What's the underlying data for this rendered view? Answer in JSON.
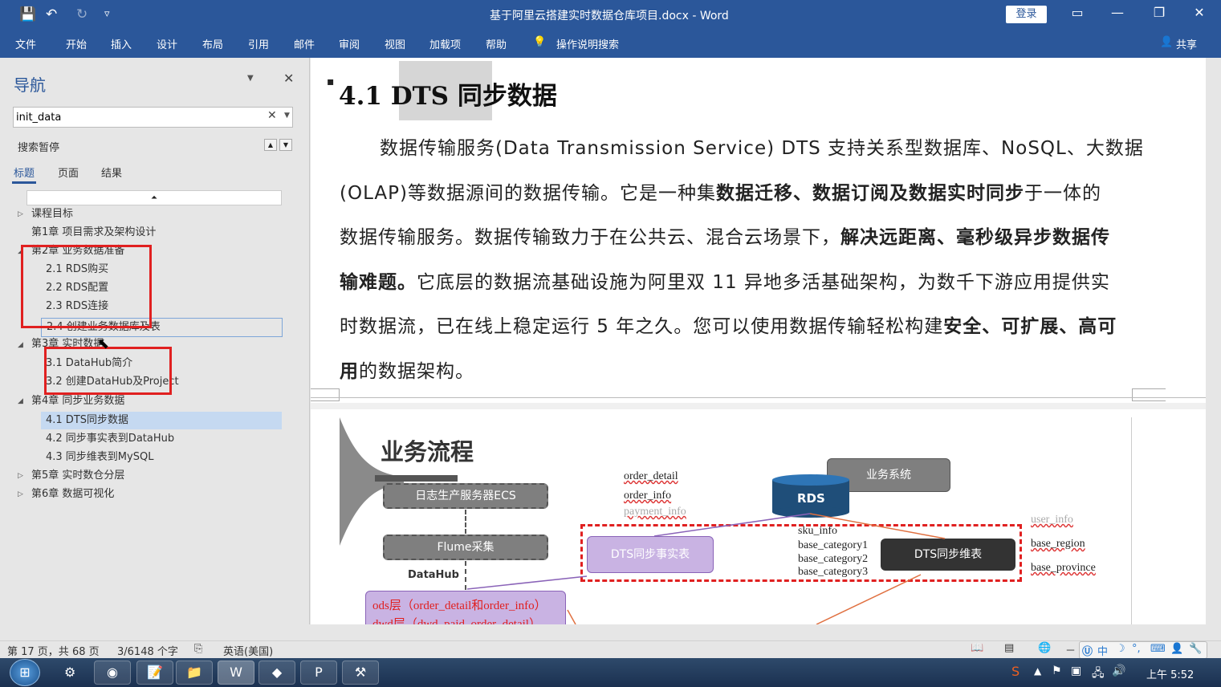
{
  "window": {
    "title": "基于阿里云搭建实时数据仓库项目.docx  -  Word",
    "login": "登录"
  },
  "qat": {
    "save": "💾",
    "undo": "↶",
    "redo": "↻",
    "customize": "▿"
  },
  "ribbon": {
    "tabs": [
      "文件",
      "开始",
      "插入",
      "设计",
      "布局",
      "引用",
      "邮件",
      "审阅",
      "视图",
      "加载项",
      "帮助"
    ],
    "tell_me": "操作说明搜索",
    "share": "共享"
  },
  "nav": {
    "title": "导航",
    "search_value": "init_data",
    "search_paused": "搜索暂停",
    "tabs": [
      "标题",
      "页面",
      "结果"
    ],
    "items": [
      "课程目标",
      "第1章 项目需求及架构设计",
      "第2章 业务数据准备",
      "2.1 RDS购买",
      "2.2 RDS配置",
      "2.3 RDS连接",
      "2.4 创建业务数据库及表",
      "第3章 实时数据",
      "3.1 DataHub简介",
      "3.2 创建DataHub及Project",
      "第4章 同步业务数据",
      "4.1 DTS同步数据",
      "4.2 同步事实表到DataHub",
      "4.3 同步维表到MySQL",
      "第5章 实时数仓分层",
      "第6章 数据可视化"
    ]
  },
  "doc": {
    "heading": "4.1 DTS 同步数据",
    "lines": [
      {
        "parts": [
          {
            "t": "数据传输服务(Data Transmission Service) DTS 支持关系型数据库、NoSQL、大数据",
            "b": false
          }
        ]
      },
      {
        "parts": [
          {
            "t": "(OLAP)等数据源间的数据传输。它是一种集",
            "b": false
          },
          {
            "t": "数据迁移、数据订阅及数据实时同步",
            "b": true
          },
          {
            "t": "于一体的",
            "b": false
          }
        ]
      },
      {
        "parts": [
          {
            "t": "数据传输服务。数据传输致力于在公共云、混合云场景下，",
            "b": false
          },
          {
            "t": "解决远距离、毫秒级异步数据传",
            "b": true
          }
        ]
      },
      {
        "parts": [
          {
            "t": "输难题。",
            "b": true
          },
          {
            "t": "它底层的数据流基础设施为阿里双 11 异地多活基础架构，为数千下游应用提供实",
            "b": false
          }
        ]
      },
      {
        "parts": [
          {
            "t": "时数据流，已在线上稳定运行 5 年之久。您可以使用数据传输轻松构建",
            "b": false
          },
          {
            "t": "安全、可扩展、高可",
            "b": true
          }
        ]
      },
      {
        "parts": [
          {
            "t": "用",
            "b": true
          },
          {
            "t": "的数据架构。",
            "b": false
          }
        ]
      }
    ],
    "diagram": {
      "title": "业务流程",
      "ecs": "日志生产服务器ECS",
      "flume": "Flume采集",
      "datahub": "DataHub",
      "ods": "ods层（order_detail和order_info）",
      "dwd": "dwd层（dwd_paid_order_detail）",
      "business_system": "业务系统",
      "rds": "RDS",
      "dts_fact": "DTS同步事实表",
      "dts_dim": "DTS同步维表",
      "fact_tables": [
        "order_detail",
        "order_info",
        "payment_info"
      ],
      "dim_tables": [
        "sku_info",
        "base_category1",
        "base_category2",
        "base_category3"
      ],
      "right_tables": [
        "user_info",
        "base_region",
        "base_province"
      ]
    }
  },
  "status": {
    "page": "第 17 页，共 68 页",
    "words": "3/6148 个字",
    "lang": "英语(美国)"
  },
  "taskbar": {
    "clock": "上午 5:52",
    "ime": "中"
  }
}
